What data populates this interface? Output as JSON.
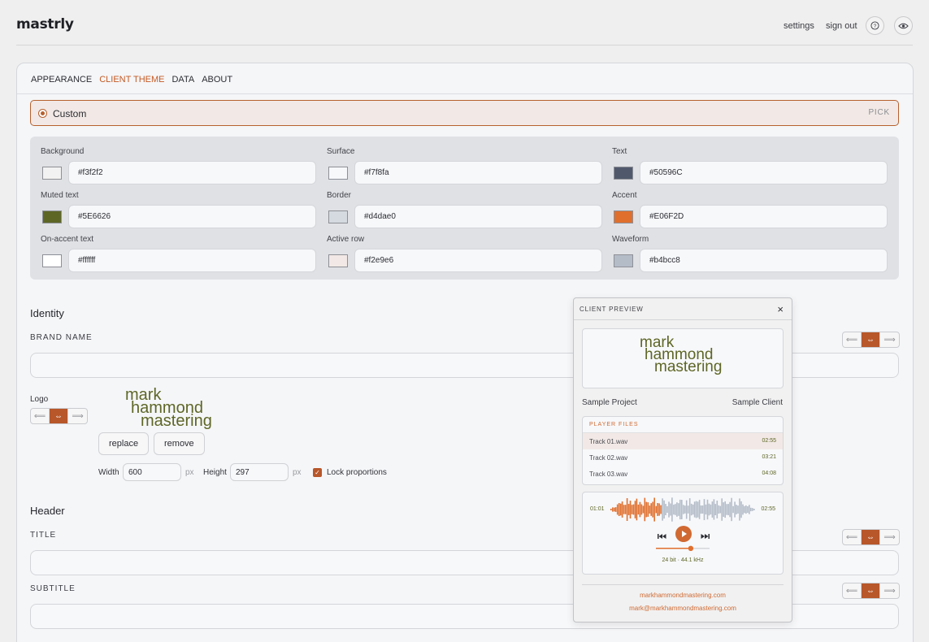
{
  "app": {
    "logo": "mastrly"
  },
  "topnav": {
    "settings": "settings",
    "signout": "sign out"
  },
  "tabs": [
    {
      "label": "APPEARANCE",
      "active": false
    },
    {
      "label": "CLIENT THEME",
      "active": true
    },
    {
      "label": "DATA",
      "active": false
    },
    {
      "label": "ABOUT",
      "active": false
    }
  ],
  "theme": {
    "selected": "Custom",
    "pick": "PICK"
  },
  "colors": [
    {
      "label": "Background",
      "hex": "#f3f2f2"
    },
    {
      "label": "Surface",
      "hex": "#f7f8fa"
    },
    {
      "label": "Text",
      "hex": "#50596C"
    },
    {
      "label": "Muted text",
      "hex": "#5E6626"
    },
    {
      "label": "Border",
      "hex": "#d4dae0"
    },
    {
      "label": "Accent",
      "hex": "#E06F2D"
    },
    {
      "label": "On-accent text",
      "hex": "#ffffff"
    },
    {
      "label": "Active row",
      "hex": "#f2e9e6"
    },
    {
      "label": "Waveform",
      "hex": "#b4bcc8"
    }
  ],
  "identity": {
    "title": "Identity",
    "brand_name_label": "BRAND NAME",
    "brand_name_value": "",
    "logo_label": "Logo",
    "logo_lines": [
      "mark",
      "hammond",
      "mastering"
    ],
    "replace": "replace",
    "remove": "remove",
    "width_label": "Width",
    "width_value": "600",
    "height_label": "Height",
    "height_value": "297",
    "px": "px",
    "lock_label": "Lock proportions",
    "lock_checked": true
  },
  "header": {
    "title": "Header",
    "title_label": "TITLE",
    "subtitle_label": "SUBTITLE",
    "title_value": "",
    "subtitle_value": ""
  },
  "align_icons": [
    "align-left-icon",
    "align-center-icon",
    "align-right-icon"
  ],
  "preview": {
    "title": "CLIENT PREVIEW",
    "close": "×",
    "project": "Sample Project",
    "client": "Sample Client",
    "files_header": "PLAYER  FILES",
    "tracks": [
      {
        "name": "Track 01.wav",
        "duration": "02:55",
        "active": true
      },
      {
        "name": "Track 02.wav",
        "duration": "03:21",
        "active": false
      },
      {
        "name": "Track 03.wav",
        "duration": "04:08",
        "active": false
      }
    ],
    "time_current": "01:01",
    "time_total": "02:55",
    "playback_progress": 0.35,
    "volume_level": 0.65,
    "format": "24 bit · 44.1 kHz",
    "website": "markhammondmastering.com",
    "email": "mark@markhammondmastering.com"
  }
}
